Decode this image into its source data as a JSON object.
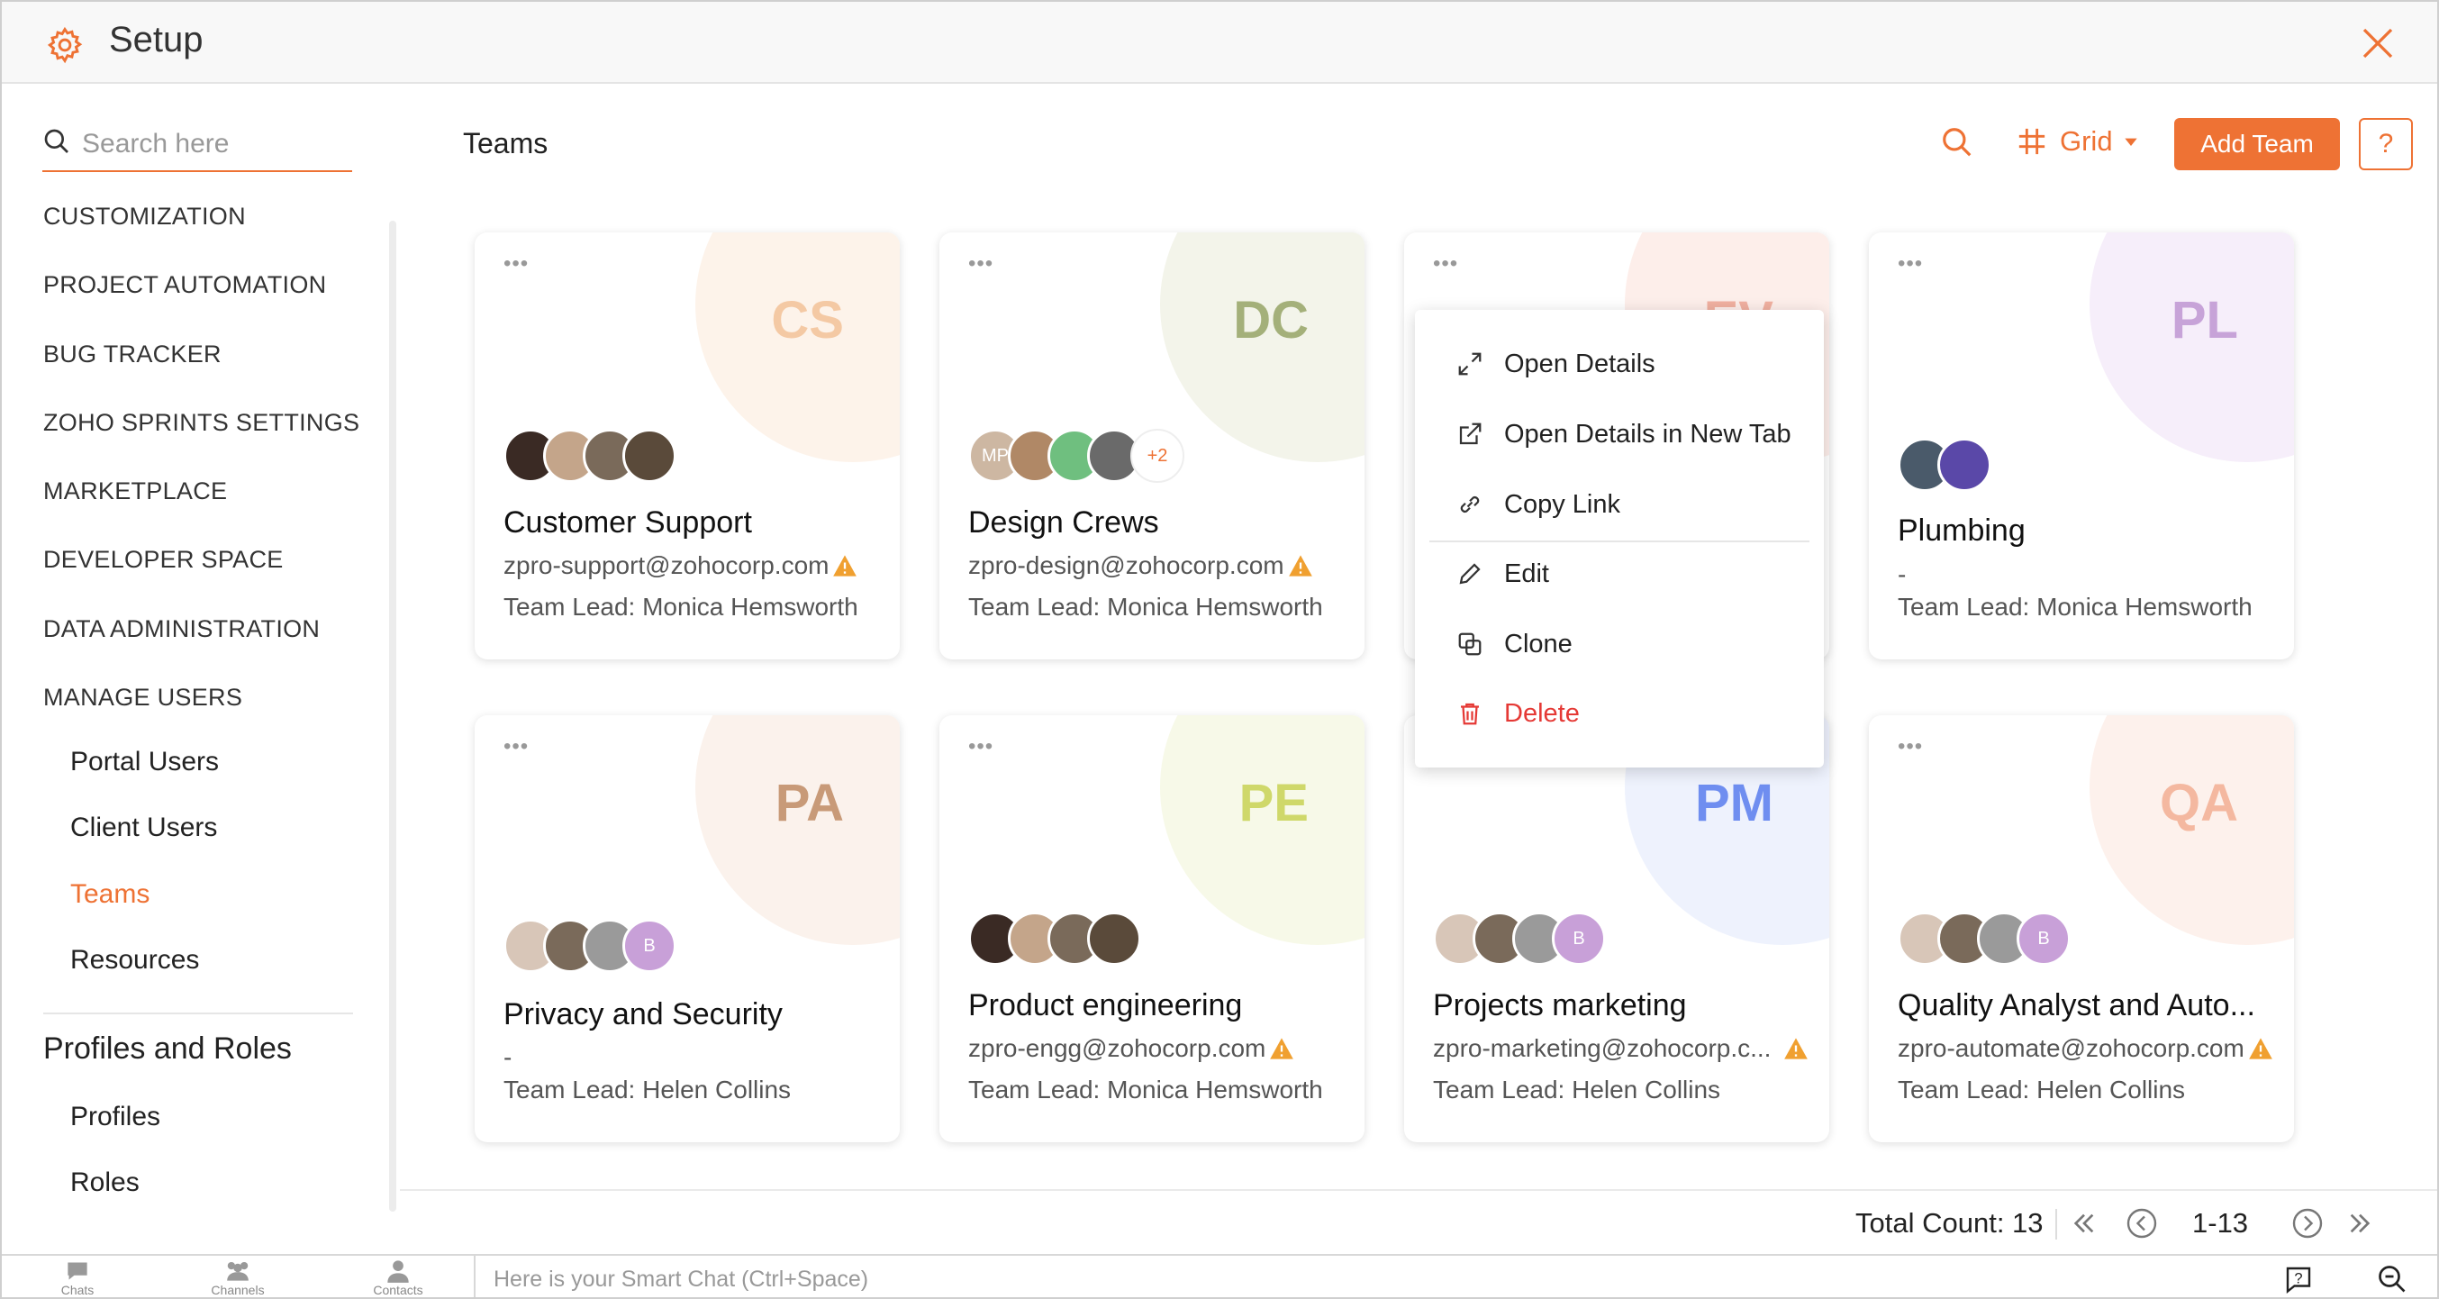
{
  "app": {
    "title": "Setup"
  },
  "sidebar": {
    "search_placeholder": "Search here",
    "sections": [
      "CUSTOMIZATION",
      "PROJECT AUTOMATION",
      "BUG TRACKER",
      "ZOHO SPRINTS SETTINGS",
      "MARKETPLACE",
      "DEVELOPER SPACE",
      "DATA ADMINISTRATION",
      "MANAGE USERS"
    ],
    "manage_users_items": [
      "Portal Users",
      "Client Users",
      "Teams",
      "Resources"
    ],
    "active_item": "Teams",
    "profiles_header": "Profiles and Roles",
    "profiles_items": [
      "Profiles",
      "Roles"
    ]
  },
  "main": {
    "title": "Teams",
    "view_label": "Grid",
    "add_button": "Add Team",
    "help_label": "?"
  },
  "teams": [
    {
      "initials": "CS",
      "name": "Customer Support",
      "email": "zpro-support@zohocorp.com",
      "email_warning": true,
      "lead": "Team Lead: Monica Hemsworth",
      "color": "#f4c9a4",
      "bg": "#fdf3ea",
      "avatars": [
        "#3a2a24",
        "#c4a58a",
        "#7a6a5a",
        "#5a4a3a"
      ],
      "extra": ""
    },
    {
      "initials": "DC",
      "name": "Design Crews",
      "email": "zpro-design@zohocorp.com",
      "email_warning": true,
      "lead": "Team Lead: Monica Hemsworth",
      "color": "#a4b07a",
      "bg": "#f3f4ea",
      "avatars": [
        "#cdb7a2",
        "#b08866",
        "#6fbf7f",
        "#6a6a6a"
      ],
      "avatar_labels": [
        "MP",
        "",
        "",
        ""
      ],
      "extra": "+2"
    },
    {
      "initials": "EV",
      "name": "",
      "email": "",
      "email_warning": false,
      "lead": "",
      "color": "#f0b0a0",
      "bg": "#fdeeea",
      "avatars": [],
      "extra": ""
    },
    {
      "initials": "PL",
      "name": "Plumbing",
      "email": "-",
      "email_warning": false,
      "lead": "Team Lead: Monica Hemsworth",
      "color": "#c7a3d8",
      "bg": "#f6eefa",
      "avatars": [
        "#4a5a6a",
        "#5a48a8"
      ],
      "extra": ""
    },
    {
      "initials": "PA",
      "name": "Privacy and Security",
      "email": "-",
      "email_warning": false,
      "lead": "Team Lead: Helen Collins",
      "color": "#c89a78",
      "bg": "#fbf2ec",
      "avatars": [
        "#d8c6b8",
        "#7a6a5a",
        "#9a9a9a",
        "#c8a0d8"
      ],
      "avatar_labels": [
        "",
        "",
        "",
        "B"
      ],
      "extra": ""
    },
    {
      "initials": "PE",
      "name": "Product engineering",
      "email": "zpro-engg@zohocorp.com",
      "email_warning": true,
      "lead": "Team Lead: Monica Hemsworth",
      "color": "#cfd86a",
      "bg": "#f7f9e8",
      "avatars": [
        "#3a2a24",
        "#c4a58a",
        "#7a6a5a",
        "#5a4a3a"
      ],
      "extra": ""
    },
    {
      "initials": "PM",
      "name": "Projects marketing",
      "email": "zpro-marketing@zohocorp.c...",
      "email_warning": true,
      "lead": "Team Lead: Helen Collins",
      "color": "#6f8ef0",
      "bg": "#eef2fd",
      "avatars": [
        "#d8c6b8",
        "#7a6a5a",
        "#9a9a9a",
        "#c8a0d8"
      ],
      "avatar_labels": [
        "",
        "",
        "",
        "B"
      ],
      "extra": ""
    },
    {
      "initials": "QA",
      "name": "Quality Analyst and Auto...",
      "email": "zpro-automate@zohocorp.com",
      "email_warning": true,
      "lead": "Team Lead: Helen Collins",
      "color": "#f4b8a0",
      "bg": "#fdf1ec",
      "avatars": [
        "#d8c6b8",
        "#7a6a5a",
        "#9a9a9a",
        "#c8a0d8"
      ],
      "avatar_labels": [
        "",
        "",
        "",
        "B"
      ],
      "extra": ""
    }
  ],
  "context_menu": {
    "items": [
      "Open Details",
      "Open Details in New Tab",
      "Copy Link",
      "Edit",
      "Clone",
      "Delete"
    ]
  },
  "footer": {
    "total_label": "Total Count: 13",
    "range": "1-13"
  },
  "bottombar": {
    "chats": "Chats",
    "channels": "Channels",
    "contacts": "Contacts",
    "smartchat_placeholder": "Here is your Smart Chat (Ctrl+Space)"
  },
  "colors": {
    "accent": "#ee7234",
    "danger": "#e53935"
  }
}
